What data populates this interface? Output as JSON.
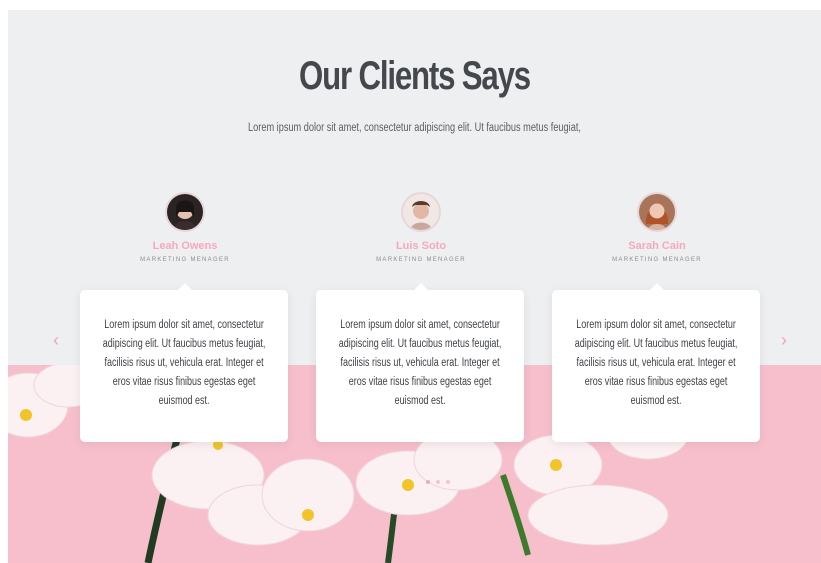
{
  "section": {
    "title": "Our Clients Says",
    "subtitle": "Lorem ipsum dolor sit amet, consectetur adipiscing elit. Ut faucibus metus feugiat,"
  },
  "testimonials": [
    {
      "name": "Leah Owens",
      "role": "MARKETING MENAGER",
      "text": "Lorem ipsum dolor sit amet, consectetur adipiscing elit. Ut faucibus metus feugiat, facilisis risus ut, vehicula erat. Integer et eros vitae risus finibus egestas eget euismod est."
    },
    {
      "name": "Luis Soto",
      "role": "MARKETING MENAGER",
      "text": "Lorem ipsum dolor sit amet, consectetur adipiscing elit. Ut faucibus metus feugiat, facilisis risus ut, vehicula erat. Integer et eros vitae risus finibus egestas eget euismod est."
    },
    {
      "name": "Sarah Cain",
      "role": "MARKETING MENAGER",
      "text": "Lorem ipsum dolor sit amet, consectetur adipiscing elit. Ut faucibus metus feugiat, facilisis risus ut, vehicula erat. Integer et eros vitae risus finibus egestas eget euismod est."
    }
  ],
  "nav": {
    "prev_icon": "‹",
    "next_icon": "›"
  },
  "colors": {
    "accent": "#f6a9bd",
    "background": "#eeeff1",
    "band": "#f7bfcc"
  }
}
